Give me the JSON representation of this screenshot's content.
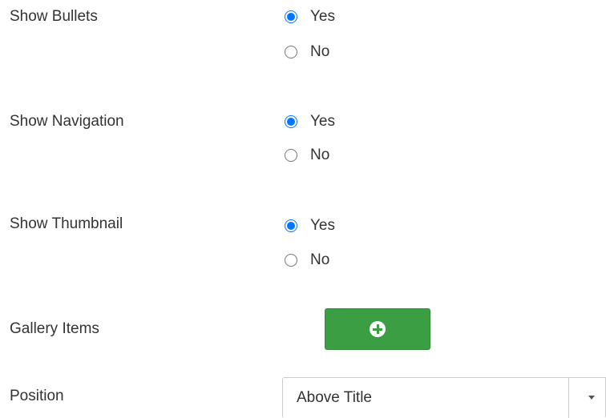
{
  "fields": [
    {
      "label": "Show Bullets",
      "options": [
        {
          "label": "Yes",
          "checked": true
        },
        {
          "label": "No",
          "checked": false
        }
      ]
    },
    {
      "label": "Show Navigation",
      "options": [
        {
          "label": "Yes",
          "checked": true
        },
        {
          "label": "No",
          "checked": false
        }
      ]
    },
    {
      "label": "Show Thumbnail",
      "options": [
        {
          "label": "Yes",
          "checked": true
        },
        {
          "label": "No",
          "checked": false
        }
      ]
    }
  ],
  "gallery": {
    "label": "Gallery Items",
    "add_button_icon": "plus-circle-icon",
    "button_color": "#3c9e42"
  },
  "position": {
    "label": "Position",
    "selected": "Above Title",
    "dropdown_icon": "caret-down-icon"
  },
  "colors": {
    "radio_accent": "#0075ff",
    "text": "#333333"
  }
}
